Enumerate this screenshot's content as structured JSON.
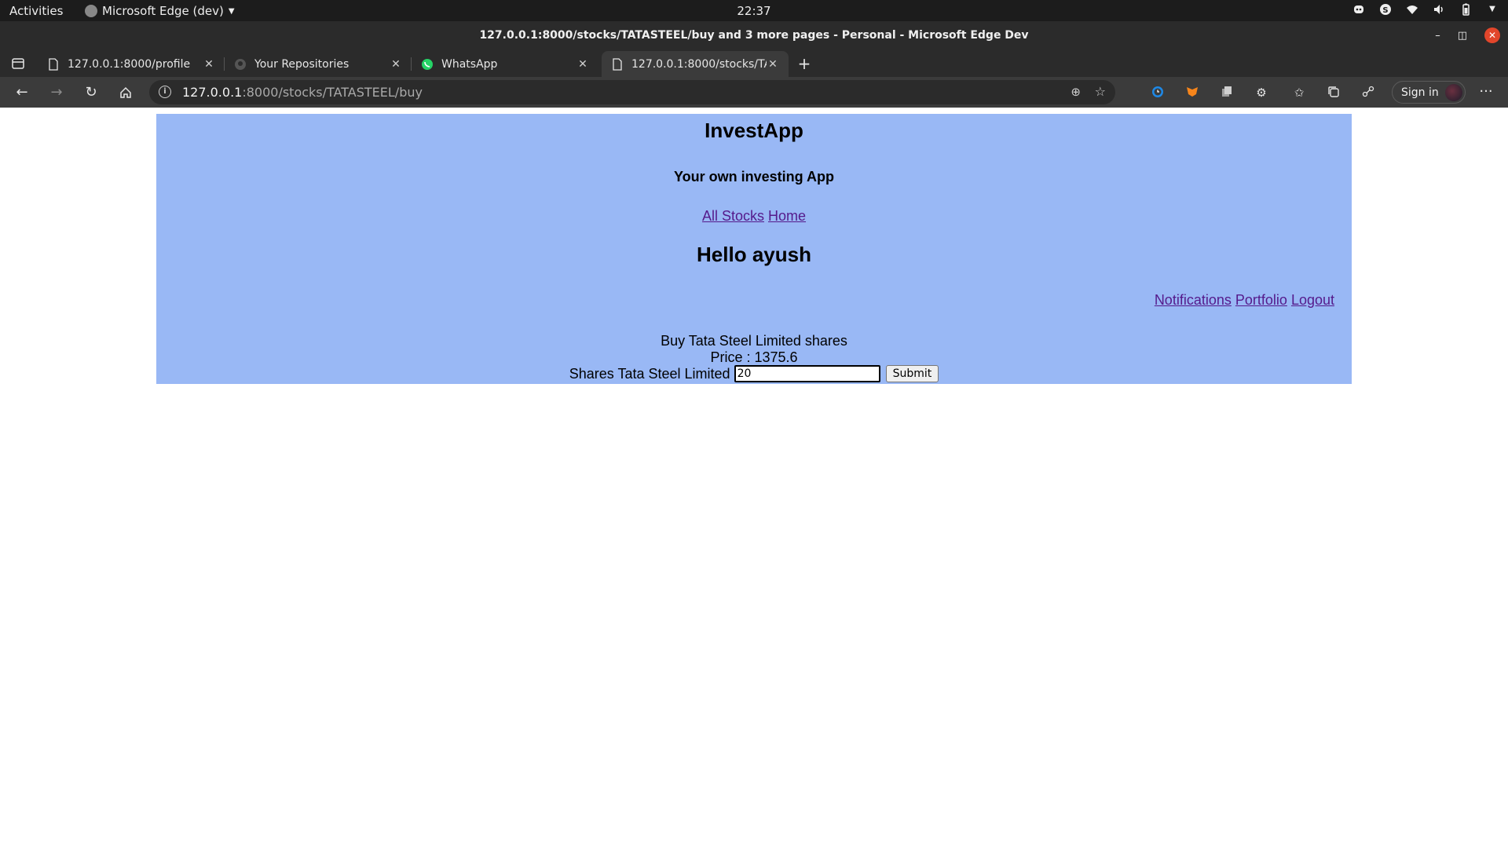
{
  "os_topbar": {
    "activities": "Activities",
    "app_name": "Microsoft Edge (dev)",
    "clock": "22:37",
    "tray_icons": [
      "discord-icon",
      "skype-icon",
      "wifi-icon",
      "volume-icon",
      "battery-icon",
      "menu-chevron-icon"
    ]
  },
  "window": {
    "title": "127.0.0.1:8000/stocks/TATASTEEL/buy and 3 more pages - Personal - Microsoft Edge Dev"
  },
  "tabs": [
    {
      "title": "127.0.0.1:8000/profile",
      "icon": "page-icon",
      "active": false
    },
    {
      "title": "Your Repositories",
      "icon": "github-icon",
      "active": false
    },
    {
      "title": "WhatsApp",
      "icon": "whatsapp-icon",
      "active": false
    },
    {
      "title": "127.0.0.1:8000/stocks/TA",
      "icon": "page-icon",
      "active": true
    }
  ],
  "address_bar": {
    "host": "127.0.0.1",
    "path": ":8000/stocks/TATASTEEL/buy"
  },
  "profile": {
    "sign_in": "Sign in"
  },
  "page": {
    "app_title": "InvestApp",
    "tagline": "Your own investing App",
    "nav": {
      "all_stocks": "All Stocks",
      "home": "Home"
    },
    "greeting": "Hello ayush",
    "user_links": {
      "notifications": "Notifications",
      "portfolio": "Portfolio",
      "logout": "Logout"
    },
    "buy_heading": "Buy Tata Steel Limited shares",
    "price": "Price : 1375.6",
    "shares_label": "Shares Tata Steel Limited",
    "shares_value": "20",
    "submit_label": "Submit"
  },
  "colors": {
    "panel_bg": "#99b8f5",
    "link": "#551a8b",
    "browser_chrome": "#3b3b3b"
  }
}
